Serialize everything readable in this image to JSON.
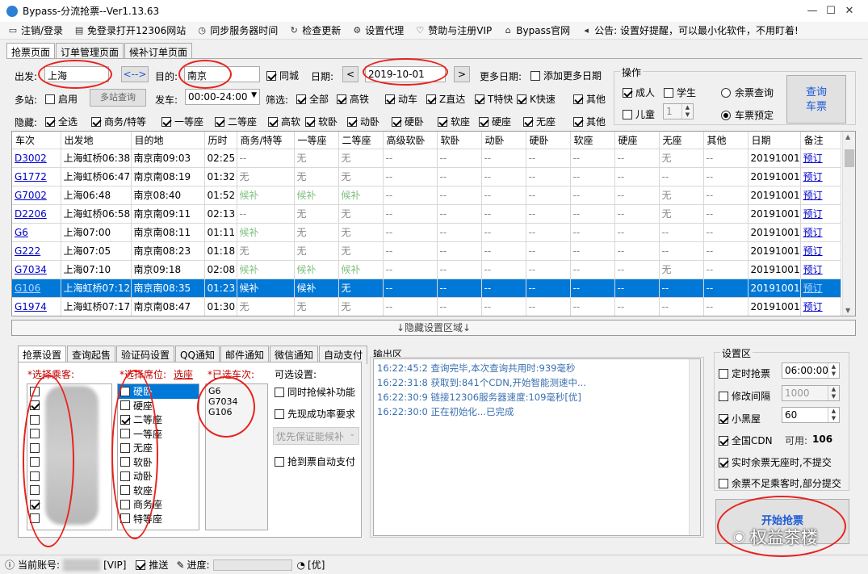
{
  "window": {
    "title": "Bypass-分流抢票--Ver1.13.63",
    "min": "—",
    "max": "☐",
    "close": "✕"
  },
  "menu": [
    {
      "icon": "▭",
      "label": "注销/登录"
    },
    {
      "icon": "▤",
      "label": "免登录打开12306网站"
    },
    {
      "icon": "◷",
      "label": "同步服务器时间"
    },
    {
      "icon": "↻",
      "label": "检查更新"
    },
    {
      "icon": "⚙",
      "label": "设置代理"
    },
    {
      "icon": "♡",
      "label": "赞助与注册VIP"
    },
    {
      "icon": "⌂",
      "label": "Bypass官网"
    },
    {
      "icon": "◂",
      "label": "公告: 设置好提醒，可以最小化软件，不用盯着!"
    }
  ],
  "tabs": [
    "抢票页面",
    "订单管理页面",
    "候补订单页面"
  ],
  "search": {
    "from_label": "出发:",
    "from": "上海",
    "swap": "<-->",
    "to_label": "目的:",
    "to": "南京",
    "same_city": "同城",
    "date_label": "日期:",
    "date": "2019-10-01",
    "prev": "<",
    "next": ">",
    "more_dates_label": "更多日期:",
    "add_dates": "添加更多日期",
    "multi_label": "多站:",
    "enable": "启用",
    "multi_query": "多站查询",
    "depart_label": "发车:",
    "depart_time": "00:00-24:00",
    "filter_label": "筛选:",
    "hide_label": "隐藏:"
  },
  "filters": [
    {
      "label": "全部",
      "on": true
    },
    {
      "label": "高铁",
      "on": true
    },
    {
      "label": "动车",
      "on": true
    },
    {
      "label": "Z直达",
      "on": true
    },
    {
      "label": "T特快",
      "on": true
    },
    {
      "label": "K快速",
      "on": true
    },
    {
      "label": "其他",
      "on": true
    }
  ],
  "hides": [
    {
      "label": "全选",
      "on": true
    },
    {
      "label": "商务/特等",
      "on": true
    },
    {
      "label": "一等座",
      "on": true
    },
    {
      "label": "二等座",
      "on": true
    },
    {
      "label": "高软",
      "on": true
    },
    {
      "label": "软卧",
      "on": true
    },
    {
      "label": "动卧",
      "on": true
    },
    {
      "label": "硬卧",
      "on": true
    },
    {
      "label": "软座",
      "on": true
    },
    {
      "label": "硬座",
      "on": true
    },
    {
      "label": "无座",
      "on": true
    },
    {
      "label": "其他",
      "on": true
    }
  ],
  "ops": {
    "title": "操作",
    "adult": "成人",
    "student": "学生",
    "child": "儿童",
    "child_count": "1",
    "remain_query": "余票查询",
    "reserve": "车票预定",
    "query_btn": "查询\n车票"
  },
  "table": {
    "headers": [
      "车次",
      "出发地",
      "目的地",
      "历时",
      "商务/特等",
      "一等座",
      "二等座",
      "高级软卧",
      "软卧",
      "动卧",
      "硬卧",
      "软座",
      "硬座",
      "无座",
      "其他",
      "日期",
      "备注"
    ],
    "rows": [
      [
        "D3002",
        "上海虹桥06:38",
        "南京南09:03",
        "02:25",
        "--",
        "无",
        "无",
        "--",
        "--",
        "--",
        "--",
        "--",
        "--",
        "无",
        "--",
        "20191001",
        "预订"
      ],
      [
        "G1772",
        "上海虹桥06:47",
        "南京南08:19",
        "01:32",
        "无",
        "无",
        "无",
        "--",
        "--",
        "--",
        "--",
        "--",
        "--",
        "--",
        "--",
        "20191001",
        "预订"
      ],
      [
        "G7002",
        "上海06:48",
        "南京08:40",
        "01:52",
        "候补",
        "候补",
        "候补",
        "--",
        "--",
        "--",
        "--",
        "--",
        "--",
        "无",
        "--",
        "20191001",
        "预订"
      ],
      [
        "D2206",
        "上海虹桥06:58",
        "南京南09:11",
        "02:13",
        "--",
        "无",
        "无",
        "--",
        "--",
        "--",
        "--",
        "--",
        "--",
        "无",
        "--",
        "20191001",
        "预订"
      ],
      [
        "G6",
        "上海07:00",
        "南京南08:11",
        "01:11",
        "候补",
        "无",
        "无",
        "--",
        "--",
        "--",
        "--",
        "--",
        "--",
        "--",
        "--",
        "20191001",
        "预订"
      ],
      [
        "G222",
        "上海07:05",
        "南京南08:23",
        "01:18",
        "无",
        "无",
        "无",
        "--",
        "--",
        "--",
        "--",
        "--",
        "--",
        "--",
        "--",
        "20191001",
        "预订"
      ],
      [
        "G7034",
        "上海07:10",
        "南京09:18",
        "02:08",
        "候补",
        "候补",
        "候补",
        "--",
        "--",
        "--",
        "--",
        "--",
        "--",
        "无",
        "--",
        "20191001",
        "预订"
      ],
      [
        "G106",
        "上海虹桥07:12",
        "南京南08:35",
        "01:23",
        "候补",
        "候补",
        "无",
        "--",
        "--",
        "--",
        "--",
        "--",
        "--",
        "--",
        "--",
        "20191001",
        "预订"
      ],
      [
        "G1974",
        "上海虹桥07:17",
        "南京南08:47",
        "01:30",
        "无",
        "无",
        "无",
        "--",
        "--",
        "--",
        "--",
        "--",
        "--",
        "--",
        "--",
        "20191001",
        "预订"
      ]
    ]
  },
  "hide_area": "↓隐藏设置区域↓",
  "settings_tabs": [
    "抢票设置",
    "查询起售",
    "验证码设置",
    "QQ通知",
    "邮件通知",
    "微信通知",
    "自动支付"
  ],
  "passengers": {
    "label": "*选择乘客:",
    "checks": [
      false,
      true,
      false,
      false,
      false,
      false,
      false,
      false,
      true,
      false
    ]
  },
  "seats": {
    "label": "*选择席位:",
    "select_link": "选座",
    "items": [
      {
        "label": "硬卧",
        "on": false,
        "sel": true
      },
      {
        "label": "硬座",
        "on": false
      },
      {
        "label": "二等座",
        "on": true
      },
      {
        "label": "一等座",
        "on": false
      },
      {
        "label": "无座",
        "on": false
      },
      {
        "label": "软卧",
        "on": false
      },
      {
        "label": "动卧",
        "on": false
      },
      {
        "label": "软座",
        "on": false
      },
      {
        "label": "商务座",
        "on": false
      },
      {
        "label": "特等座",
        "on": false
      }
    ]
  },
  "trains": {
    "label": "*已选车次:",
    "items": [
      "G6",
      "G7034",
      "G106"
    ]
  },
  "options": {
    "label": "可选设置:",
    "waitlist": "同时抢候补功能",
    "success_first": "先现成功率要求",
    "priority": "优先保证能候补",
    "autopay": "抢到票自动支付"
  },
  "output": {
    "label": "输出区",
    "lines": [
      "16:22:45:2  查询完毕,本次查询共用时:939毫秒",
      "16:22:31:8  获取到:841个CDN,开始智能测速中...",
      "16:22:30:9  链接12306服务器速度:109毫秒[优]",
      "16:22:30:0  正在初始化...已完成"
    ]
  },
  "settings": {
    "label": "设置区",
    "timed": "定时抢票",
    "timed_value": "06:00:00",
    "interval": "修改间隔",
    "interval_value": "1000",
    "blackroom": "小黑屋",
    "blackroom_value": "60",
    "cdn": "全国CDN",
    "cdn_avail_label": "可用:",
    "cdn_avail": "106",
    "realtime": "实时余票无座时,不提交",
    "partial": "余票不足乘客时,部分提交",
    "start": "开始抢票"
  },
  "watermark": "权益茶楼",
  "status": {
    "account_label": "当前账号:",
    "vip": "[VIP]",
    "push": "推送",
    "progress": "进度:",
    "speed": "[优]"
  }
}
